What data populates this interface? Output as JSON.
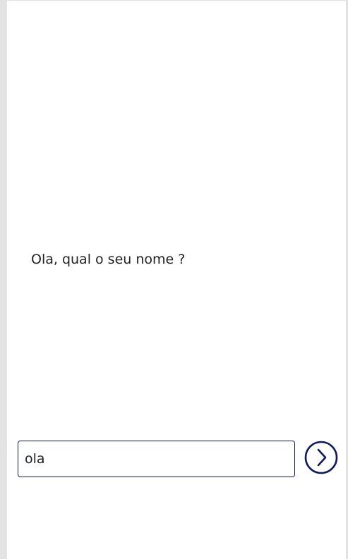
{
  "screen": {
    "prompt_text": "Ola, qual o seu nome ?",
    "input": {
      "value": "ola",
      "placeholder": ""
    },
    "submit_button": {
      "icon": "chevron-right-circle-icon"
    }
  },
  "colors": {
    "accent": "#0f1a5c",
    "background": "#ffffff",
    "outer_background": "#e3e3e3",
    "text": "#222222"
  }
}
